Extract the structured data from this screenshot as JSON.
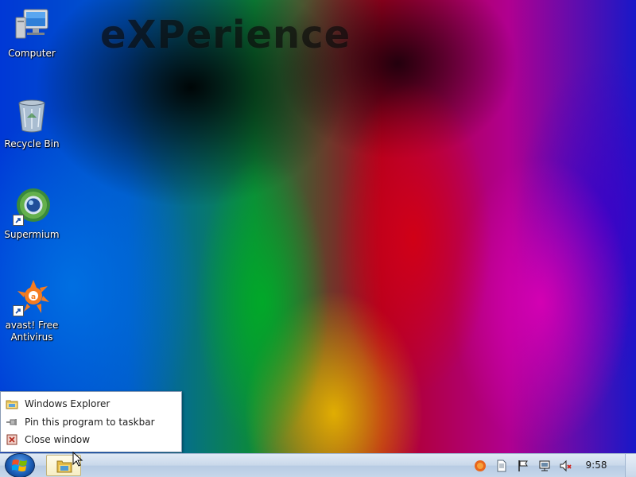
{
  "wallpaper": {
    "brand_text": "eXPerience"
  },
  "desktop_icons": [
    {
      "label": "Computer",
      "icon": "computer-icon"
    },
    {
      "label": "Recycle Bin",
      "icon": "recycle-bin-icon"
    },
    {
      "label": "Supermium",
      "icon": "supermium-browser-icon",
      "shortcut": true
    },
    {
      "label": "avast! Free Antivirus",
      "icon": "avast-icon",
      "shortcut": true
    }
  ],
  "jumplist": {
    "items": [
      {
        "label": "Windows Explorer",
        "icon": "folder-icon"
      },
      {
        "label": "Pin this program to taskbar",
        "icon": "pin-icon"
      },
      {
        "label": "Close window",
        "icon": "close-window-icon"
      }
    ]
  },
  "taskbar": {
    "start_icon": "windows-logo-icon",
    "tasks": [
      {
        "name": "Windows Explorer",
        "icon": "folder-libraries-icon",
        "active": true
      }
    ],
    "tray_icons": [
      "avast-tray-icon",
      "document-tray-icon",
      "action-center-flag-icon",
      "network-icon",
      "volume-muted-icon"
    ],
    "clock": "9:58"
  },
  "colors": {
    "taskbar": "#c9d8ea",
    "jumplist_bg": "#ffffff",
    "desktop_text": "#ffffff"
  }
}
